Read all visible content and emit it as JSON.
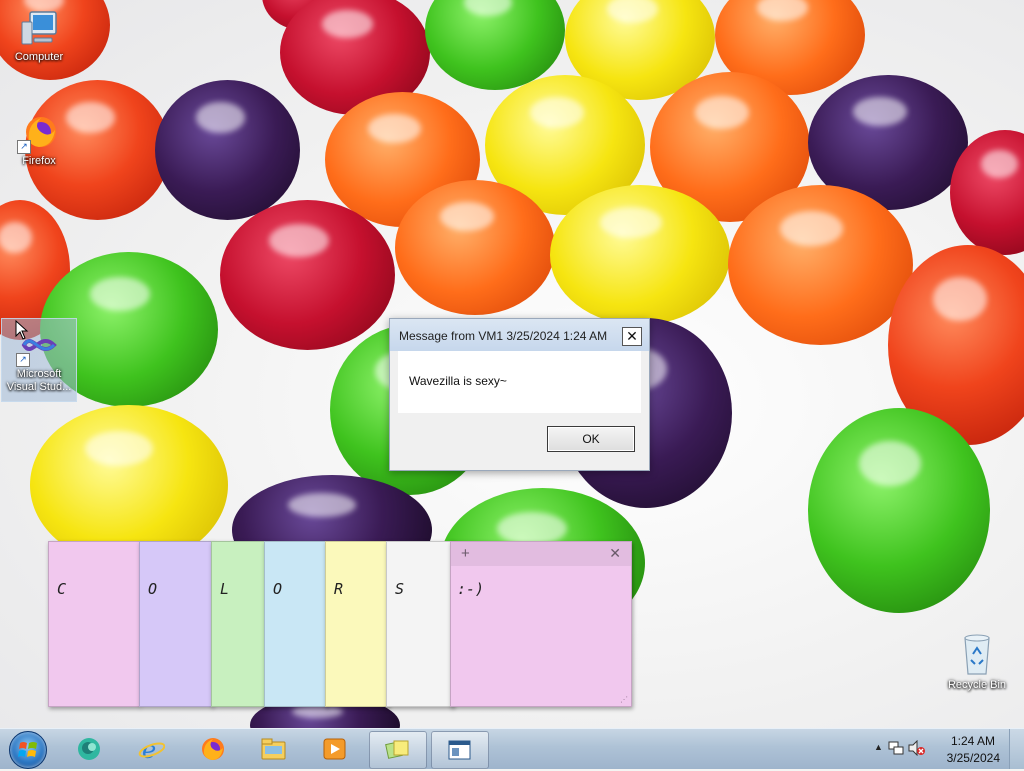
{
  "desktop": {
    "icons": [
      {
        "label": "Computer"
      },
      {
        "label": "Firefox"
      },
      {
        "label": "Microsoft Visual Stud..."
      },
      {
        "label": "Recycle Bin"
      }
    ]
  },
  "message_box": {
    "title": "Message from VM1 3/25/2024 1:24 AM",
    "close_label": "✕",
    "body": "Wavezilla is sexy~",
    "ok_label": "OK"
  },
  "sticky_notes": [
    {
      "text": "C",
      "color": "#f1c8ee"
    },
    {
      "text": "O",
      "color": "#d6c8f8"
    },
    {
      "text": "L",
      "color": "#c8f0bf"
    },
    {
      "text": "O",
      "color": "#c9e7f5"
    },
    {
      "text": "R",
      "color": "#fbf9bb"
    },
    {
      "text": "S",
      "color": "#f4f4f4"
    },
    {
      "text": ":-)",
      "color": "#f1c8ee",
      "plus": "+",
      "close": "✕",
      "grip": "⋰"
    }
  ],
  "taskbar": {
    "pinned": [
      {
        "name": "start"
      },
      {
        "name": "messenger-icon"
      },
      {
        "name": "internet-explorer-icon"
      },
      {
        "name": "firefox-icon"
      },
      {
        "name": "file-explorer-icon"
      },
      {
        "name": "media-player-icon"
      },
      {
        "name": "sticky-notes-icon"
      },
      {
        "name": "message-window-icon"
      }
    ],
    "tray": {
      "arrow": "▲",
      "time": "1:24 AM",
      "date": "3/25/2024"
    }
  }
}
